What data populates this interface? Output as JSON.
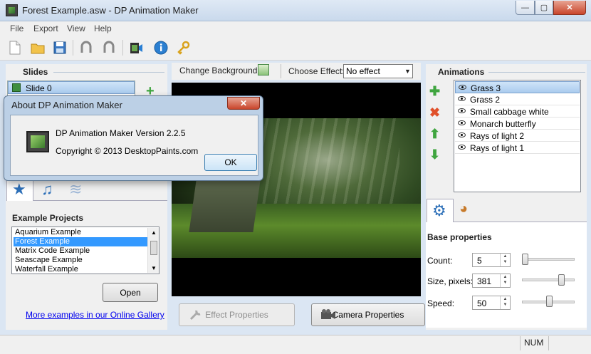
{
  "window": {
    "title": "Forest Example.asw - DP Animation Maker",
    "close": "✕",
    "minimize": "—",
    "maximize": "▢"
  },
  "menu": [
    "File",
    "Export",
    "View",
    "Help"
  ],
  "toolbar": {
    "icons": [
      "new-file-icon",
      "open-folder-icon",
      "save-icon",
      "undo-icon",
      "redo-icon",
      "export-video-icon",
      "info-icon",
      "key-icon"
    ]
  },
  "slides": {
    "heading": "Slides",
    "items": [
      "Slide 0"
    ],
    "add": "+"
  },
  "examples": {
    "heading": "Example Projects",
    "items": [
      "Aquarium Example",
      "Forest Example",
      "Matrix Code Example",
      "Seascape Example",
      "Waterfall Example"
    ],
    "selected": "Forest Example",
    "open_label": "Open",
    "gallery_link": "More examples in our Online Gallery"
  },
  "center": {
    "change_background": "Change Background",
    "choose_effect_label": "Choose Effect:",
    "effect_value": "No effect",
    "effect_properties": "Effect Properties",
    "camera_properties": "Camera Properties"
  },
  "animations": {
    "heading": "Animations",
    "items": [
      "Grass 3",
      "Grass 2",
      "Small cabbage white",
      "Monarch butterfly",
      "Rays of light 2",
      "Rays of light 1"
    ],
    "selected": "Grass 3"
  },
  "base_properties": {
    "heading": "Base properties",
    "count_label": "Count:",
    "count_value": "5",
    "size_label": "Size, pixels:",
    "size_value": "381",
    "speed_label": "Speed:",
    "speed_value": "50"
  },
  "status": {
    "num": "NUM"
  },
  "about_dialog": {
    "title": "About DP Animation Maker",
    "version": "DP Animation Maker Version 2.2.5",
    "copyright": "Copyright © 2013 DesktopPaints.com",
    "ok": "OK",
    "close": "✕"
  },
  "colors": {
    "accent": "#3399ff",
    "link": "#0000ee",
    "selection": "#aacbee"
  }
}
